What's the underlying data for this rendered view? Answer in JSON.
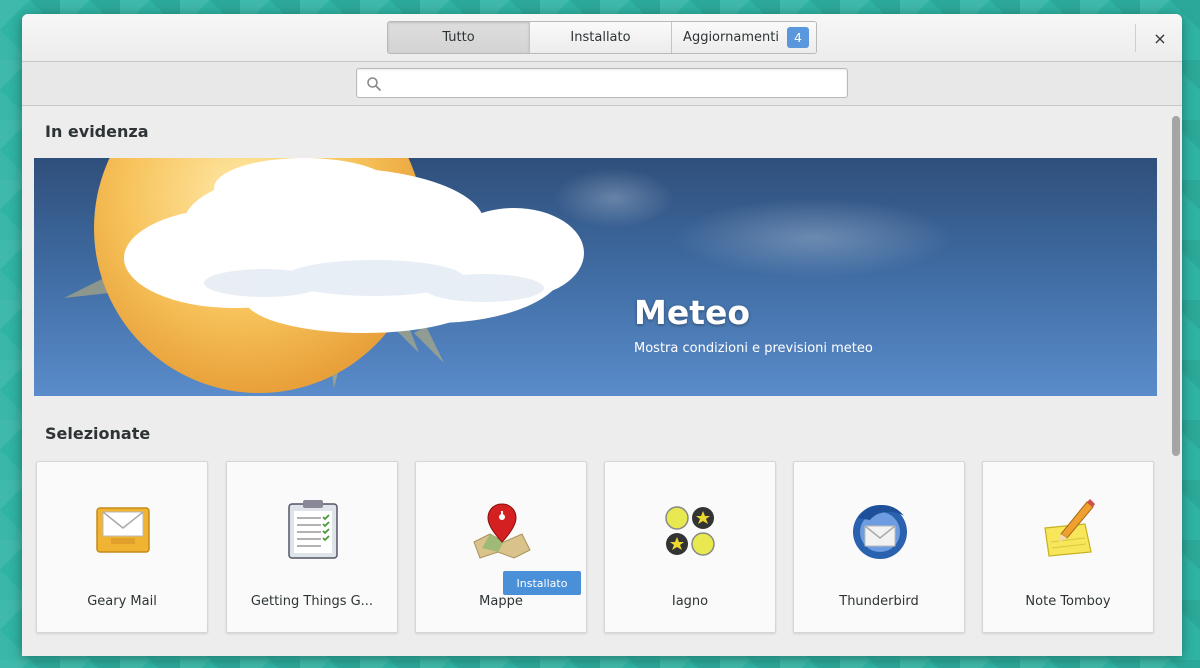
{
  "header": {
    "tabs": [
      {
        "label": "Tutto",
        "active": true
      },
      {
        "label": "Installato",
        "active": false
      },
      {
        "label": "Aggiornamenti",
        "active": false
      }
    ],
    "updates_count": "4",
    "close_icon": "×"
  },
  "search": {
    "placeholder": "",
    "value": ""
  },
  "featured": {
    "section_title": "In evidenza",
    "app_name": "Meteo",
    "app_description": "Mostra condizioni e previsioni meteo"
  },
  "picks": {
    "section_title": "Selezionate",
    "apps": [
      {
        "name": "Geary Mail",
        "icon": "mail-icon"
      },
      {
        "name": "Getting Things G...",
        "icon": "checklist-icon"
      },
      {
        "name": "Mappe",
        "icon": "map-pin-icon",
        "installed_label": "Installato"
      },
      {
        "name": "Iagno",
        "icon": "game-pieces-icon"
      },
      {
        "name": "Thunderbird",
        "icon": "thunderbird-icon"
      },
      {
        "name": "Note Tomboy",
        "icon": "note-pencil-icon"
      }
    ]
  },
  "colors": {
    "accent": "#4a90d9",
    "badge": "#5b97dc",
    "banner_top": "#2f4f7b",
    "banner_bottom": "#5a8ccb",
    "desktop": "#2fb3a3"
  }
}
